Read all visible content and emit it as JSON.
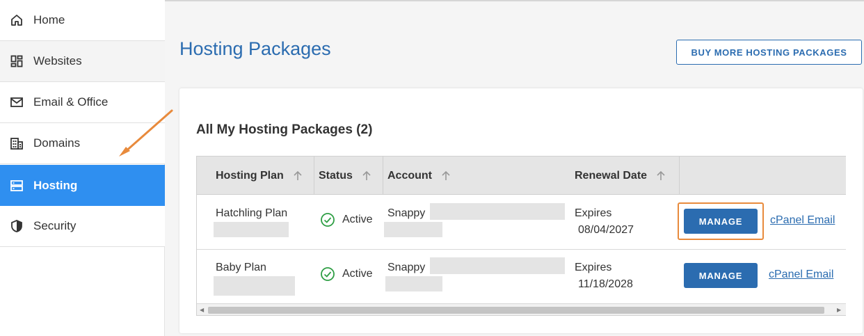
{
  "sidebar": {
    "items": [
      {
        "label": "Home",
        "icon": "home-icon"
      },
      {
        "label": "Websites",
        "icon": "dashboard-icon"
      },
      {
        "label": "Email & Office",
        "icon": "mail-icon"
      },
      {
        "label": "Domains",
        "icon": "building-icon"
      },
      {
        "label": "Hosting",
        "icon": "server-icon",
        "active": true
      },
      {
        "label": "Security",
        "icon": "shield-icon"
      }
    ]
  },
  "main": {
    "title": "Hosting Packages",
    "buy_button": "BUY MORE HOSTING PACKAGES",
    "card_title": "All My Hosting Packages (2)",
    "columns": [
      "Hosting Plan",
      "Status",
      "Account",
      "Renewal Date"
    ],
    "rows": [
      {
        "plan": "Hatchling Plan",
        "status": "Active",
        "account": "Snappy",
        "renewal_prefix": "Expires",
        "renewal_date": "08/04/2027",
        "manage": "MANAGE",
        "link": "cPanel Email"
      },
      {
        "plan": "Baby Plan",
        "status": "Active",
        "account": "Snappy",
        "renewal_prefix": "Expires",
        "renewal_date": "11/18/2028",
        "manage": "MANAGE",
        "link": "cPanel Email"
      }
    ]
  },
  "colors": {
    "accent": "#2b6cb0",
    "active_nav": "#2f8ff0",
    "highlight": "#e88a3c",
    "success": "#2e9e44"
  }
}
